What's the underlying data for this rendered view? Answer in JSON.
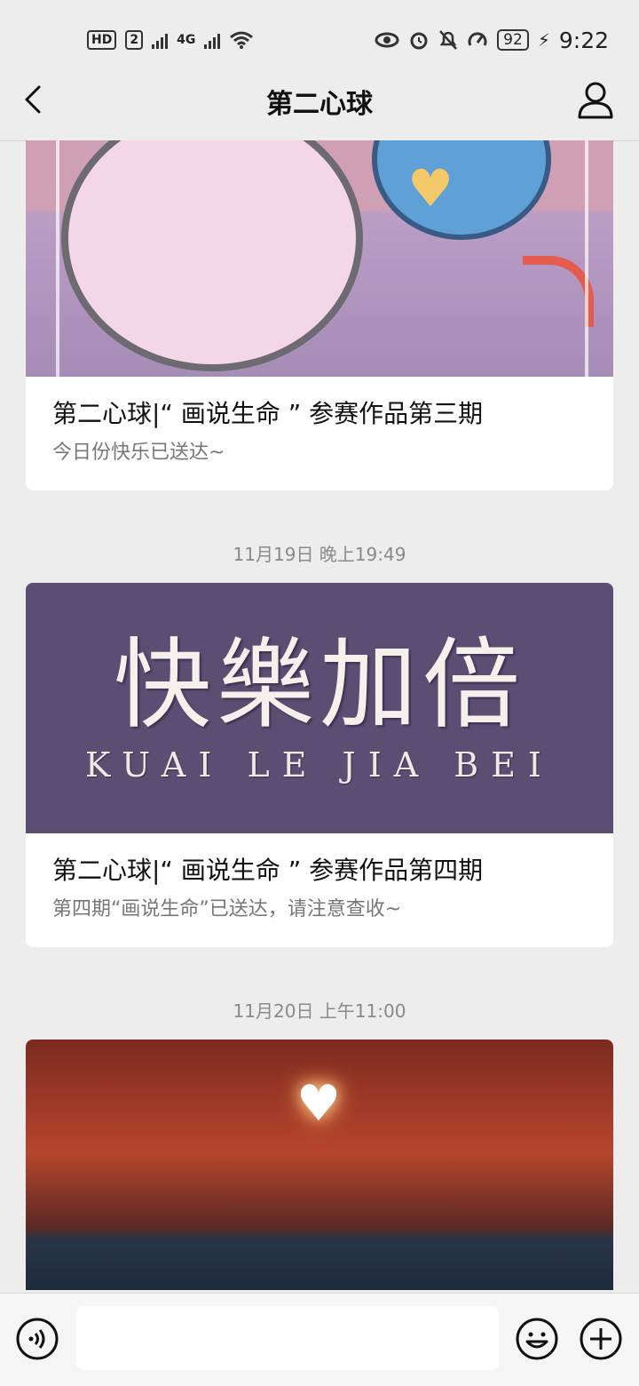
{
  "status_bar": {
    "hd_badge": "HD",
    "sim_number": "2",
    "network": "4G",
    "battery": "92",
    "time": "9:22"
  },
  "header": {
    "title": "第二心球"
  },
  "messages": [
    {
      "title": "第二心球|“ 画说生命 ” 参赛作品第三期",
      "description": "今日份快乐已送达~"
    },
    {
      "timestamp": "11月19日 晚上19:49",
      "cover_text_cn": "快樂加倍",
      "cover_text_en": "KUAI LE JIA BEI",
      "title": "第二心球|“ 画说生命 ” 参赛作品第四期",
      "description": "第四期“画说生命”已送达，请注意查收~"
    },
    {
      "timestamp": "11月20日 上午11:00"
    }
  ],
  "colors": {
    "background": "#ededed",
    "card": "#ffffff",
    "timestamp_text": "#8a8a8a"
  },
  "icons": {
    "back": "chevron-left-icon",
    "profile": "person-icon",
    "voice": "voice-icon",
    "emoji": "emoji-icon",
    "plus": "plus-icon"
  }
}
